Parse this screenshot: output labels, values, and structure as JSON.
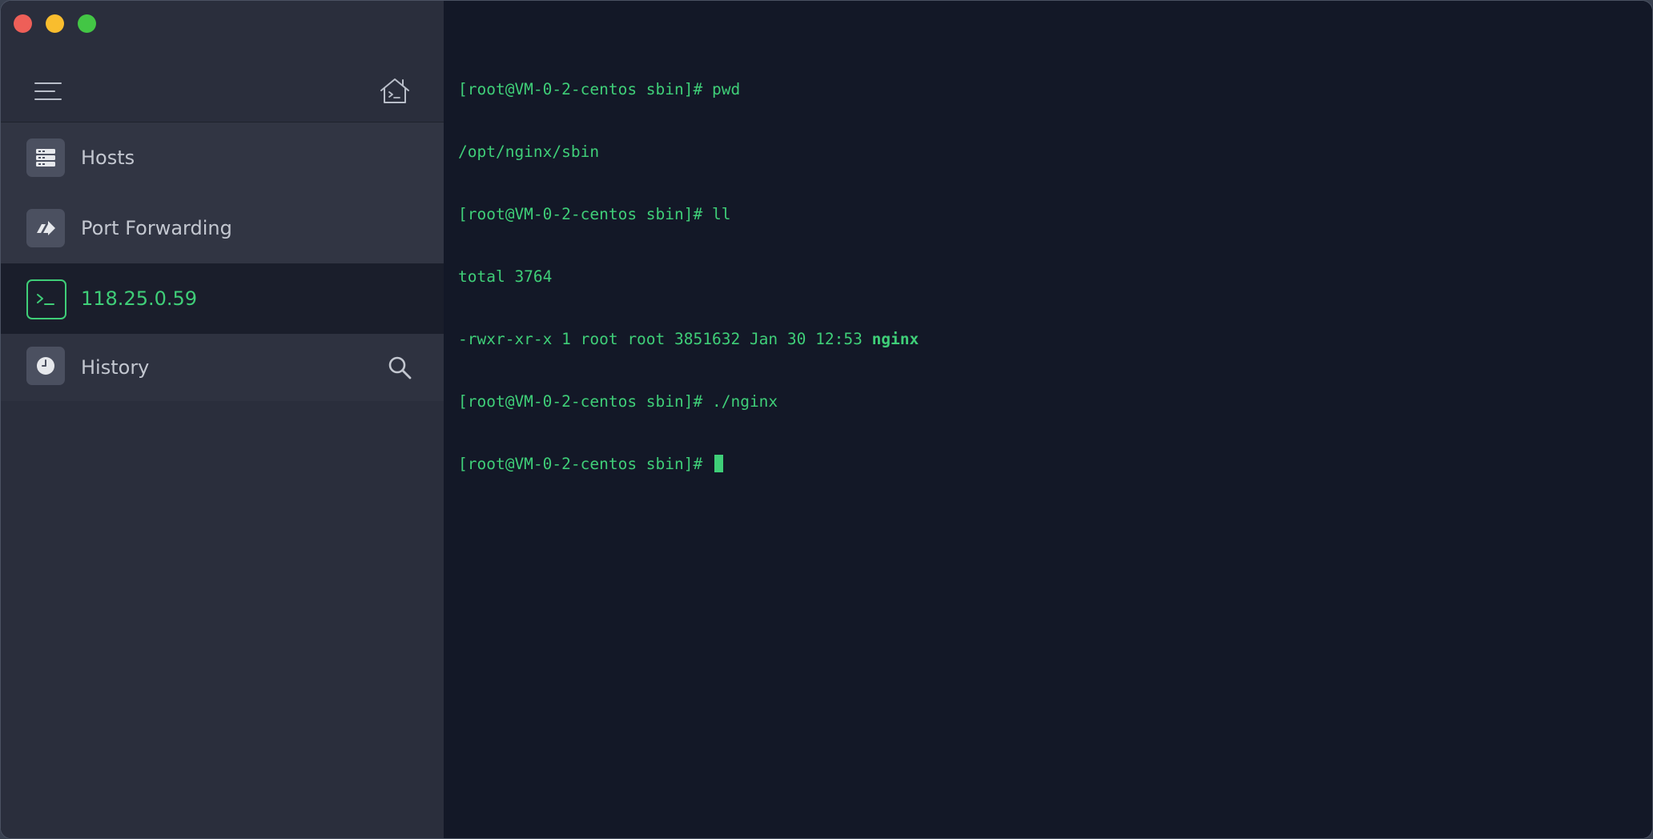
{
  "window": {
    "controls": [
      "close",
      "minimize",
      "maximize"
    ]
  },
  "sidebar": {
    "top": {
      "menu_icon": "hamburger-menu-icon",
      "home_icon": "home-terminal-icon"
    },
    "nav": [
      {
        "label": "Hosts",
        "icon": "server-icon"
      },
      {
        "label": "Port Forwarding",
        "icon": "port-forward-arrow-icon"
      }
    ],
    "active_session": {
      "label": "118.25.0.59",
      "icon": "terminal-prompt-icon"
    },
    "history": {
      "label": "History",
      "icon": "clock-icon",
      "action_icon": "search-icon"
    }
  },
  "terminal": {
    "lines": [
      {
        "text": "[root@VM-0-2-centos sbin]# pwd"
      },
      {
        "text": "/opt/nginx/sbin"
      },
      {
        "text": "[root@VM-0-2-centos sbin]# ll"
      },
      {
        "text": "total 3764"
      },
      {
        "text": "-rwxr-xr-x 1 root root 3851632 Jan 30 12:53 ",
        "bold": "nginx"
      },
      {
        "text": "[root@VM-0-2-centos sbin]# ./nginx"
      },
      {
        "text": "[root@VM-0-2-centos sbin]# "
      }
    ],
    "colors": {
      "foreground": "#3fce78",
      "background": "#131827"
    }
  }
}
